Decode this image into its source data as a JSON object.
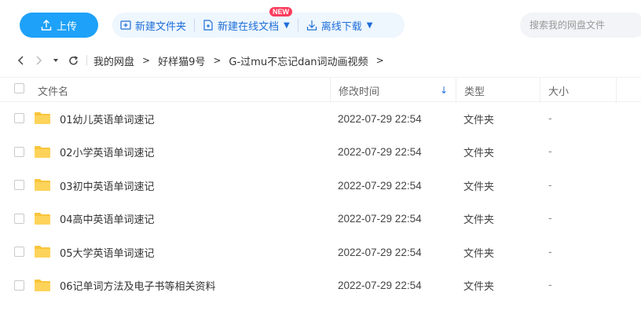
{
  "toolbar": {
    "upload_label": "上传",
    "new_folder_label": "新建文件夹",
    "new_online_doc_label": "新建在线文档",
    "new_badge": "NEW",
    "offline_download_label": "离线下载",
    "search_placeholder": "搜索我的网盘文件",
    "accent_color": "#1ea1f8"
  },
  "breadcrumb": {
    "items": [
      "我的网盘",
      "好样猫9号",
      "G-过mu不忘记dan词动画视频"
    ],
    "separator": ">"
  },
  "table": {
    "headers": {
      "name": "文件名",
      "modified": "修改时间",
      "type": "类型",
      "size": "大小"
    },
    "sort": "修改时间 descending",
    "rows": [
      {
        "name": "01幼儿英语单词速记",
        "modified": "2022-07-29 22:54",
        "type": "文件夹",
        "size": "-"
      },
      {
        "name": "02小学英语单词速记",
        "modified": "2022-07-29 22:54",
        "type": "文件夹",
        "size": "-"
      },
      {
        "name": "03初中英语单词速记",
        "modified": "2022-07-29 22:54",
        "type": "文件夹",
        "size": "-"
      },
      {
        "name": "04高中英语单词速记",
        "modified": "2022-07-29 22:54",
        "type": "文件夹",
        "size": "-"
      },
      {
        "name": "05大学英语单词速记",
        "modified": "2022-07-29 22:54",
        "type": "文件夹",
        "size": "-"
      },
      {
        "name": "06记单词方法及电子书等相关资料",
        "modified": "2022-07-29 22:54",
        "type": "文件夹",
        "size": "-"
      }
    ]
  }
}
